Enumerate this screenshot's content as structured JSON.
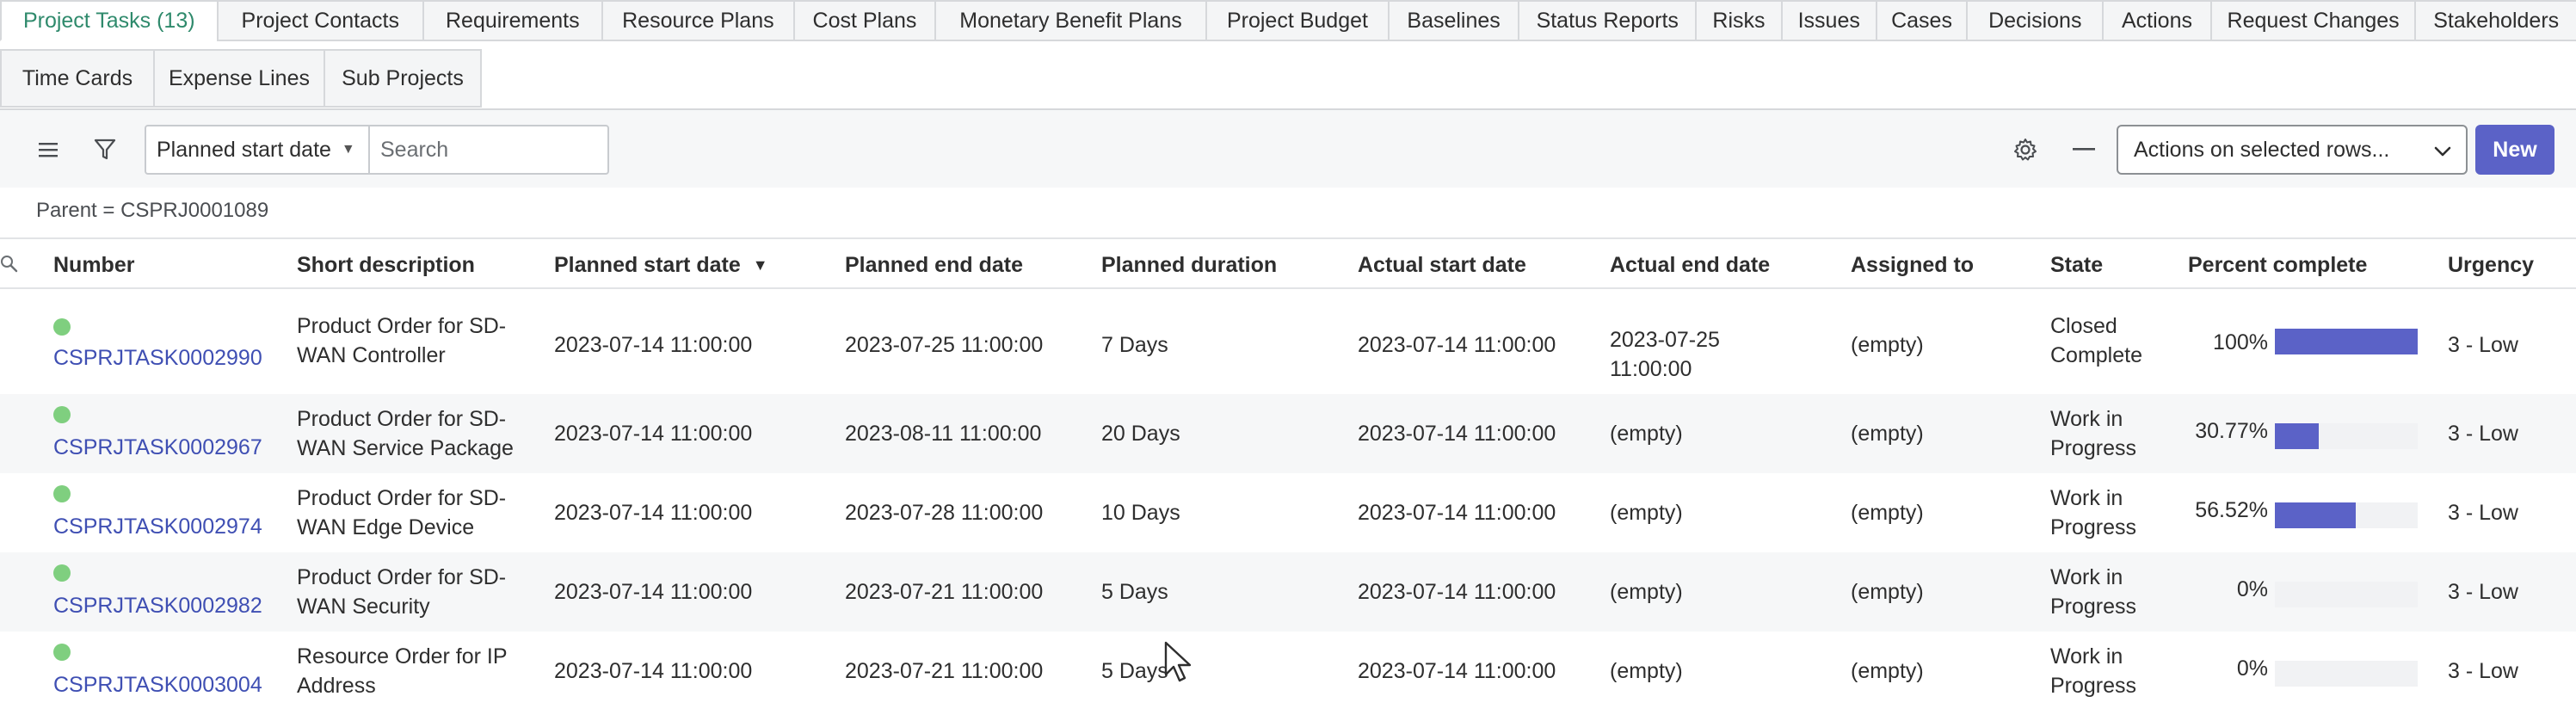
{
  "tabs_row1": [
    {
      "label": "Project Tasks (13)",
      "active": true
    },
    {
      "label": "Project Contacts"
    },
    {
      "label": "Requirements"
    },
    {
      "label": "Resource Plans"
    },
    {
      "label": "Cost Plans"
    },
    {
      "label": "Monetary Benefit Plans"
    },
    {
      "label": "Project Budget"
    },
    {
      "label": "Baselines"
    },
    {
      "label": "Status Reports"
    },
    {
      "label": "Risks"
    },
    {
      "label": "Issues"
    },
    {
      "label": "Cases"
    },
    {
      "label": "Decisions"
    },
    {
      "label": "Actions"
    },
    {
      "label": "Request Changes"
    },
    {
      "label": "Stakeholders"
    }
  ],
  "tabs_row2": [
    {
      "label": "Time Cards"
    },
    {
      "label": "Expense Lines"
    },
    {
      "label": "Sub Projects"
    }
  ],
  "toolbar": {
    "field_select": "Planned start date",
    "search_placeholder": "Search",
    "actions_select": "Actions on selected rows...",
    "new_label": "New"
  },
  "breadcrumb": "Parent = CSPRJ0001089",
  "columns": [
    {
      "label": "Number"
    },
    {
      "label": "Short description"
    },
    {
      "label": "Planned start date",
      "sorted": "desc"
    },
    {
      "label": "Planned end date"
    },
    {
      "label": "Planned duration"
    },
    {
      "label": "Actual start date"
    },
    {
      "label": "Actual end date"
    },
    {
      "label": "Assigned to"
    },
    {
      "label": "State"
    },
    {
      "label": "Percent complete"
    },
    {
      "label": "Urgency"
    }
  ],
  "rows": [
    {
      "number": "CSPRJTASK0002990",
      "desc1": "Product Order for SD-",
      "desc2": "WAN Controller",
      "planned_start": "2023-07-14 11:00:00",
      "planned_end": "2023-07-25 11:00:00",
      "duration": "7 Days",
      "actual_start": "2023-07-14 11:00:00",
      "actual_end1": "2023-07-25",
      "actual_end2": "11:00:00",
      "assigned": "(empty)",
      "state1": "Closed",
      "state2": "Complete",
      "percent_text": "100%",
      "percent": 100,
      "urgency": "3 - Low"
    },
    {
      "number": "CSPRJTASK0002967",
      "desc1": "Product Order for SD-",
      "desc2": "WAN Service Package",
      "planned_start": "2023-07-14 11:00:00",
      "planned_end": "2023-08-11 11:00:00",
      "duration": "20 Days",
      "actual_start": "2023-07-14 11:00:00",
      "actual_end1": "(empty)",
      "actual_end2": "",
      "assigned": "(empty)",
      "state1": "Work in",
      "state2": "Progress",
      "percent_text": "30.77%",
      "percent": 30.77,
      "urgency": "3 - Low"
    },
    {
      "number": "CSPRJTASK0002974",
      "desc1": "Product Order for SD-",
      "desc2": "WAN Edge Device",
      "planned_start": "2023-07-14 11:00:00",
      "planned_end": "2023-07-28 11:00:00",
      "duration": "10 Days",
      "actual_start": "2023-07-14 11:00:00",
      "actual_end1": "(empty)",
      "actual_end2": "",
      "assigned": "(empty)",
      "state1": "Work in",
      "state2": "Progress",
      "percent_text": "56.52%",
      "percent": 56.52,
      "urgency": "3 - Low"
    },
    {
      "number": "CSPRJTASK0002982",
      "desc1": "Product Order for SD-",
      "desc2": "WAN Security",
      "planned_start": "2023-07-14 11:00:00",
      "planned_end": "2023-07-21 11:00:00",
      "duration": "5 Days",
      "actual_start": "2023-07-14 11:00:00",
      "actual_end1": "(empty)",
      "actual_end2": "",
      "assigned": "(empty)",
      "state1": "Work in",
      "state2": "Progress",
      "percent_text": "0%",
      "percent": 0,
      "urgency": "3 - Low"
    },
    {
      "number": "CSPRJTASK0003004",
      "desc1": "Resource Order for IP",
      "desc2": "Address",
      "planned_start": "2023-07-14 11:00:00",
      "planned_end": "2023-07-21 11:00:00",
      "duration": "5 Days",
      "actual_start": "2023-07-14 11:00:00",
      "actual_end1": "(empty)",
      "actual_end2": "",
      "assigned": "(empty)",
      "state1": "Work in",
      "state2": "Progress",
      "percent_text": "0%",
      "percent": 0,
      "urgency": "3 - Low"
    }
  ],
  "colors": {
    "accent": "#5b62c7",
    "link": "#3f4fb3",
    "active_tab": "#2f8a6c",
    "status_dot": "#7fcf7f"
  }
}
